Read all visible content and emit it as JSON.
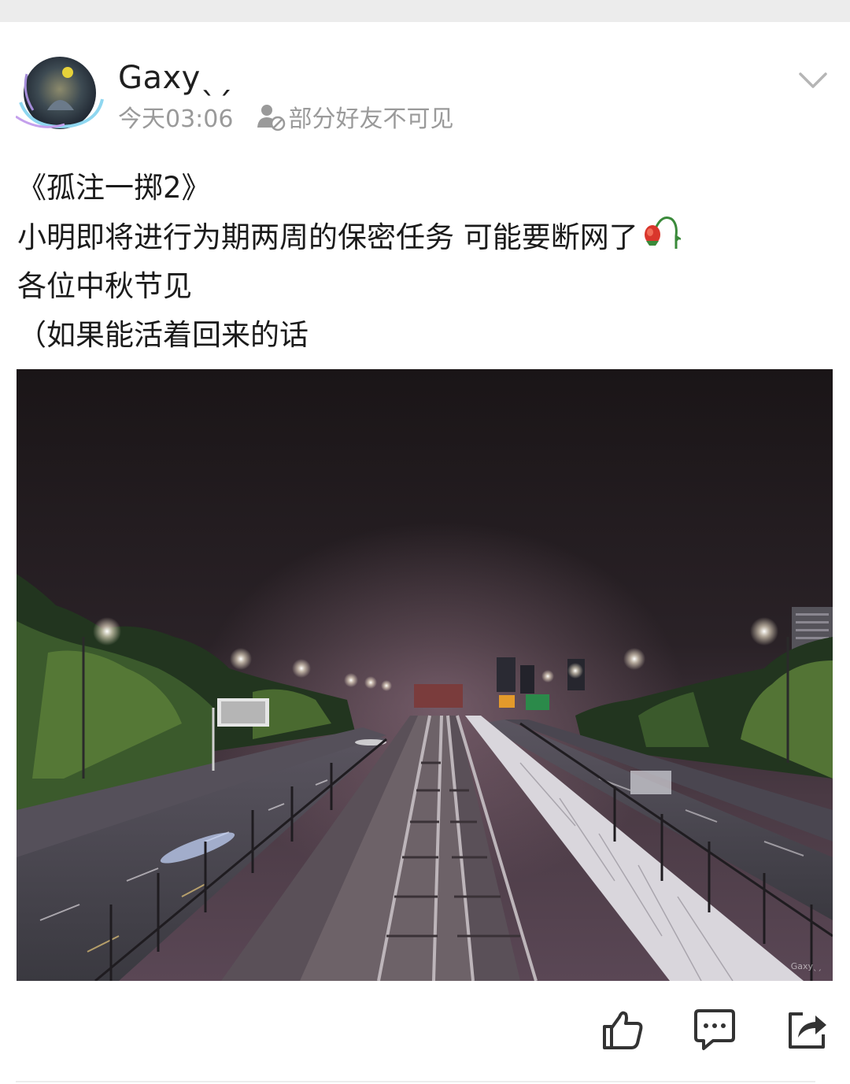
{
  "post": {
    "username": "Gaxyˎˏ",
    "time": "今天03:06",
    "visibility": "部分好友不可见",
    "lines": [
      "《孤注一掷2》",
      "小明即将进行为期两周的保密任务 可能要断网了",
      "各位中秋节见",
      "（如果能活着回来的话"
    ],
    "emoji": "wilted-rose-emoji"
  },
  "photo": {
    "watermark": "Gaxyˎˏ",
    "description_icon": "night-railway-photo"
  },
  "actions": {
    "like_icon": "thumbs-up-icon",
    "comment_icon": "comment-icon",
    "share_icon": "share-icon"
  },
  "colors": {
    "card": "#ffffff",
    "background": "#ececec",
    "meta_text": "#9a9a9a",
    "icon": "#333333"
  }
}
